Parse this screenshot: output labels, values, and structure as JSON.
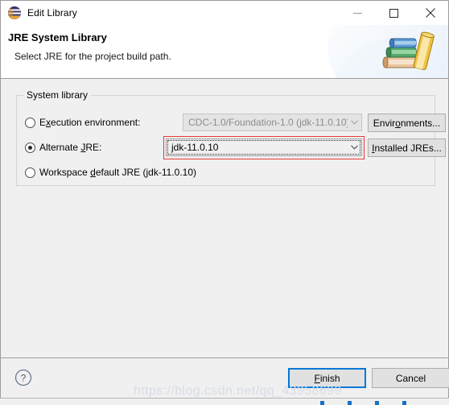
{
  "window": {
    "title": "Edit Library",
    "icon": "eclipse-icon",
    "controls": {
      "minimize": "minimize-icon",
      "maximize": "maximize-icon",
      "close": "close-icon"
    }
  },
  "banner": {
    "title": "JRE System Library",
    "subtitle": "Select JRE for the project build path.",
    "icon": "books-stack-icon"
  },
  "group": {
    "label": "System library",
    "options": [
      {
        "id": "execution-environment",
        "label_prefix": "E",
        "label_mnemonic": "x",
        "label_suffix": "ecution environment:",
        "selected": false,
        "combo_value": "CDC-1.0/Foundation-1.0 (jdk-11.0.10)",
        "combo_enabled": false,
        "button": {
          "prefix": "Envir",
          "mnemonic": "o",
          "suffix": "nments..."
        }
      },
      {
        "id": "alternate-jre",
        "label_prefix": "Alternate ",
        "label_mnemonic": "J",
        "label_suffix": "RE:",
        "selected": true,
        "combo_value": "jdk-11.0.10",
        "combo_enabled": true,
        "button": {
          "prefix": "",
          "mnemonic": "I",
          "suffix": "nstalled JREs..."
        }
      },
      {
        "id": "workspace-default-jre",
        "label_prefix": "Workspace ",
        "label_mnemonic": "d",
        "label_suffix": "efault JRE (jdk-11.0.10)",
        "selected": false
      }
    ]
  },
  "footer": {
    "help": "help-icon",
    "finish": {
      "prefix": "",
      "mnemonic": "F",
      "suffix": "inish"
    },
    "cancel": "Cancel"
  },
  "watermark": "https://blog.csdn.net/qq_43958699",
  "colors": {
    "accent": "#0078d7",
    "annotation": "#e53935",
    "dialog_bg": "#f0f0f0",
    "banner_bg": "#ffffff"
  }
}
